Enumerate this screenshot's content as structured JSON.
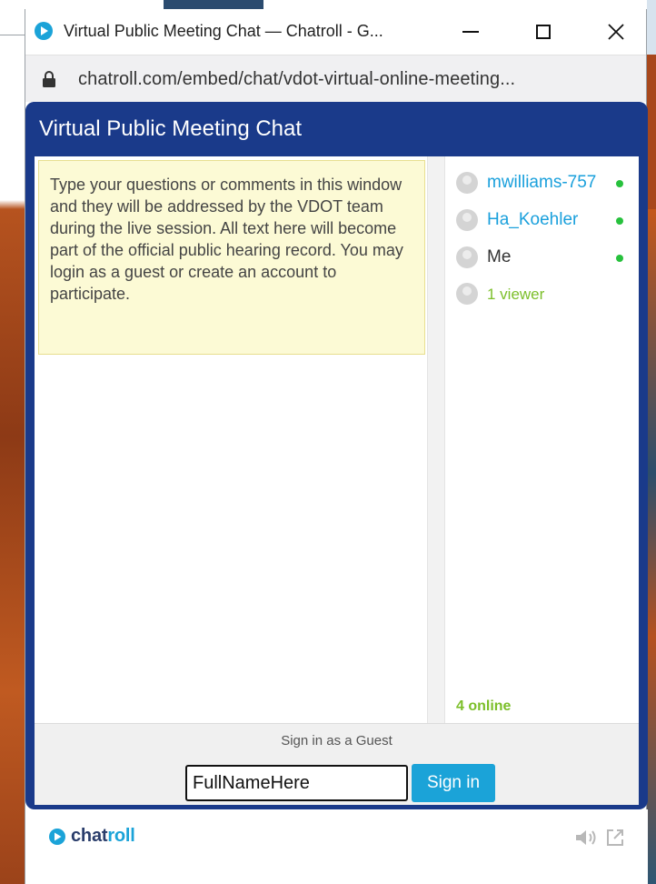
{
  "window": {
    "title": "Virtual Public Meeting Chat — Chatroll - G...",
    "url": "chatroll.com/embed/chat/vdot-virtual-online-meeting..."
  },
  "chat": {
    "header_title": "Virtual Public Meeting Chat",
    "notice": "Type your questions or comments in this window and they will be addressed by the VDOT team during the live session. All text here will become part of the official public hearing record. You may login as a guest or create an account to participate.",
    "users": [
      {
        "name": "mwilliams-757",
        "online": true
      },
      {
        "name": "Ha_Koehler",
        "online": true
      },
      {
        "name": "Me",
        "online": true
      },
      {
        "name": "1 viewer",
        "online": false
      }
    ],
    "online_count": "4 online",
    "signin": {
      "label": "Sign in as a Guest",
      "input_value": "FullNameHere",
      "button_label": "Sign in"
    }
  },
  "footer": {
    "brand_prefix": "chat",
    "brand_suffix": "roll"
  },
  "colors": {
    "frame": "#1a3a8a",
    "link": "#1aa0dc",
    "online": "#27c13d",
    "viewer": "#7cbf2a",
    "button": "#1ba3d8",
    "notice_bg": "#fcfad5"
  }
}
